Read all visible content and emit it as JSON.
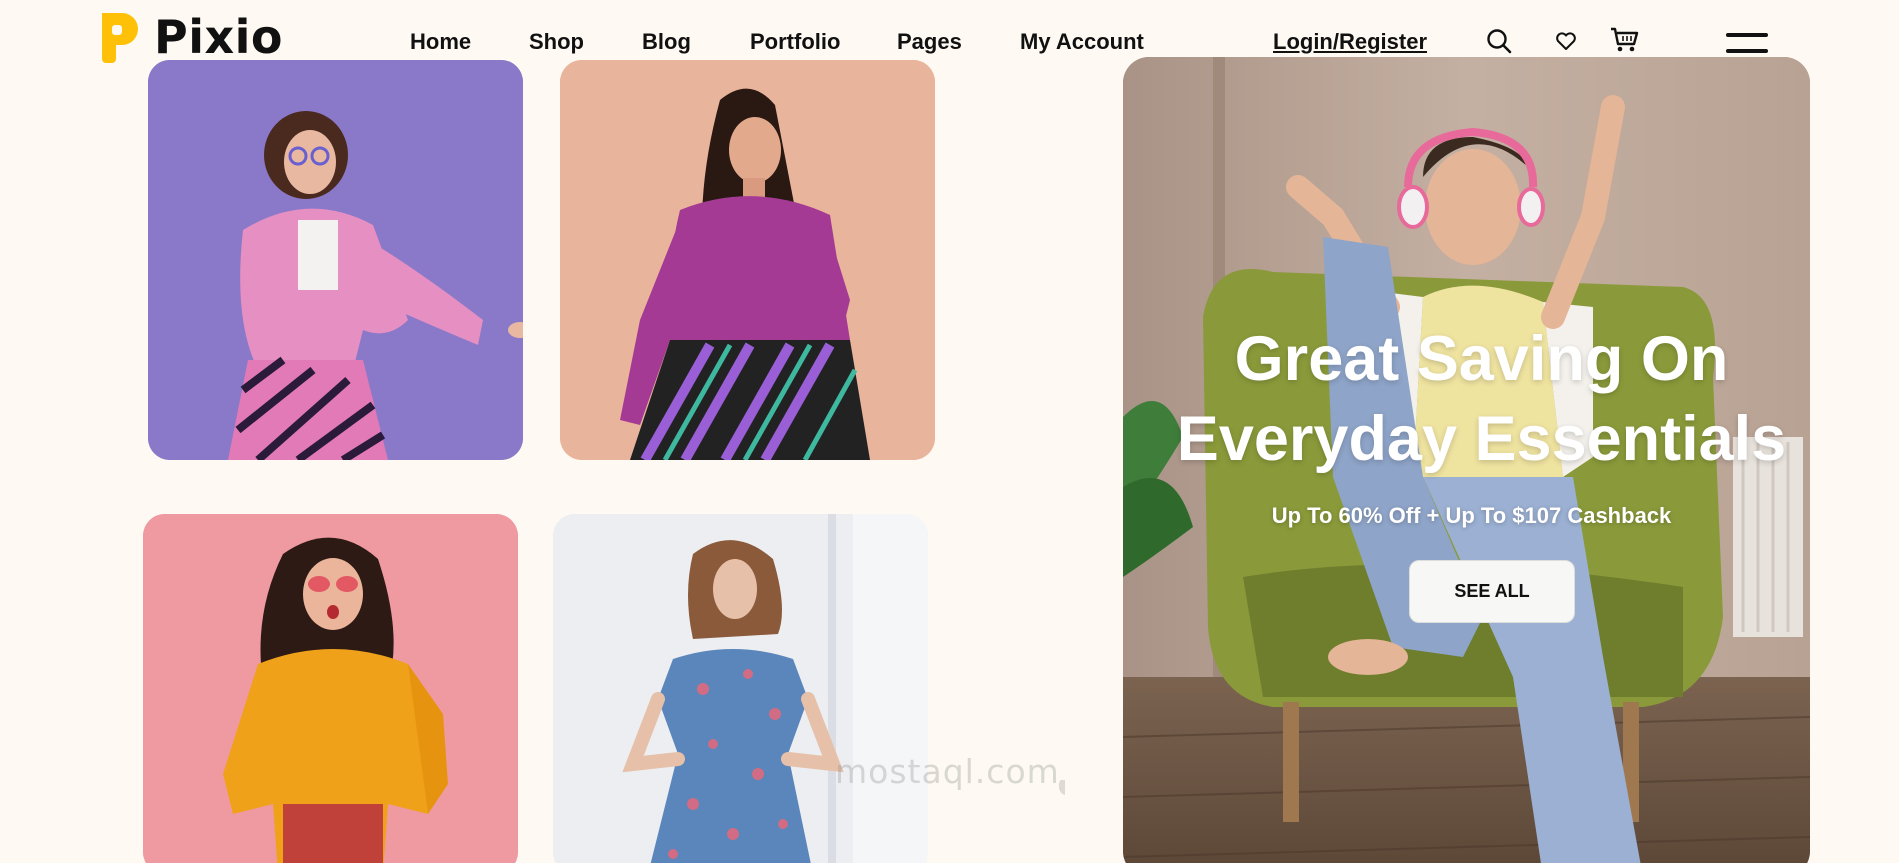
{
  "brand": {
    "name": "Pixio",
    "accent": "#ffc107"
  },
  "nav": {
    "items": [
      {
        "label": "Home"
      },
      {
        "label": "Shop"
      },
      {
        "label": "Blog"
      },
      {
        "label": "Portfolio"
      },
      {
        "label": "Pages"
      },
      {
        "label": "My Account"
      }
    ],
    "login": "Login/Register"
  },
  "icons": [
    "search-icon",
    "heart-icon",
    "cart-icon",
    "menu-icon"
  ],
  "products": [
    {
      "name": "woman-pink-fur-coat-purple-bg",
      "bg": "#8a78c8"
    },
    {
      "name": "woman-magenta-sweater-peach-bg",
      "bg": "#e9b49c"
    },
    {
      "name": "woman-yellow-shirt-pink-bg",
      "bg": "#ef9aa0"
    },
    {
      "name": "woman-floral-dress-white-bg",
      "bg": "#eceef2"
    }
  ],
  "hero": {
    "title_line1": "Great Saving On",
    "title_line2": "Everyday Essentials",
    "subtitle": "Up To 60% Off + Up To $107 Cashback",
    "cta": "SEE ALL"
  },
  "watermark": {
    "text": "mostaql.com",
    "arabic": "مستقل"
  }
}
